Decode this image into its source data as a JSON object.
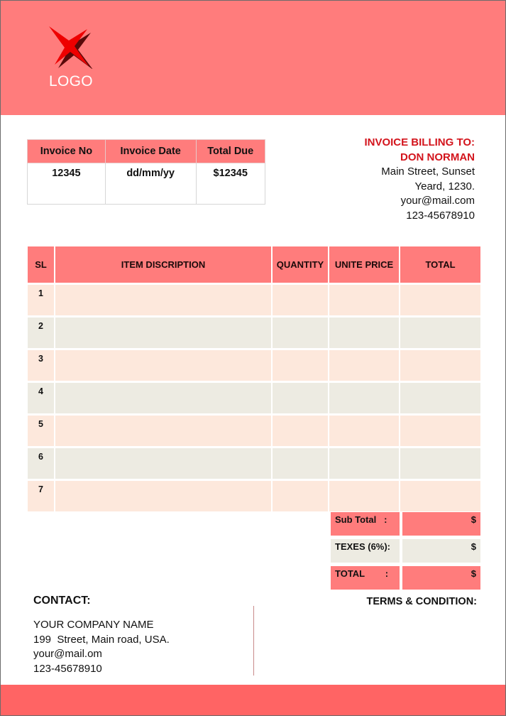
{
  "header": {
    "logo_text": "LOGO",
    "logo_icon": "x-star-icon",
    "color": "#ff7c7c"
  },
  "invoice_meta": {
    "headers": [
      "Invoice No",
      "Invoice Date",
      "Total Due"
    ],
    "values": [
      "12345",
      "dd/mm/yy",
      "$12345"
    ]
  },
  "billing": {
    "title": "INVOICE BILLING TO:",
    "name": "DON NORMAN",
    "address_line1": "Main Street, Sunset",
    "address_line2": "Yeard, 1230.",
    "email": "your@mail.com",
    "phone": "123-45678910",
    "accent_color": "#d3141c"
  },
  "items_table": {
    "headers": [
      "SL",
      "ITEM DISCRIPTION",
      "QUANTITY",
      "UNITE PRICE",
      "TOTAL"
    ],
    "rows": [
      {
        "sl": "1",
        "description": "",
        "quantity": "",
        "unit_price": "",
        "total": ""
      },
      {
        "sl": "2",
        "description": "",
        "quantity": "",
        "unit_price": "",
        "total": ""
      },
      {
        "sl": "3",
        "description": "",
        "quantity": "",
        "unit_price": "",
        "total": ""
      },
      {
        "sl": "4",
        "description": "",
        "quantity": "",
        "unit_price": "",
        "total": ""
      },
      {
        "sl": "5",
        "description": "",
        "quantity": "",
        "unit_price": "",
        "total": ""
      },
      {
        "sl": "6",
        "description": "",
        "quantity": "",
        "unit_price": "",
        "total": ""
      },
      {
        "sl": "7",
        "description": "",
        "quantity": "",
        "unit_price": "",
        "total": ""
      }
    ]
  },
  "totals": [
    {
      "label": "Sub Total   :",
      "value": "$"
    },
    {
      "label": "TEXES (6%):",
      "value": "$"
    },
    {
      "label": "TOTAL        :",
      "value": "$"
    }
  ],
  "contact": {
    "title": "CONTACT:",
    "company": "YOUR COMPANY NAME",
    "address": "199  Street, Main road, USA.",
    "email": "your@mail.om",
    "phone": "123-45678910"
  },
  "terms": {
    "title": "TERMS & CONDITION:"
  }
}
